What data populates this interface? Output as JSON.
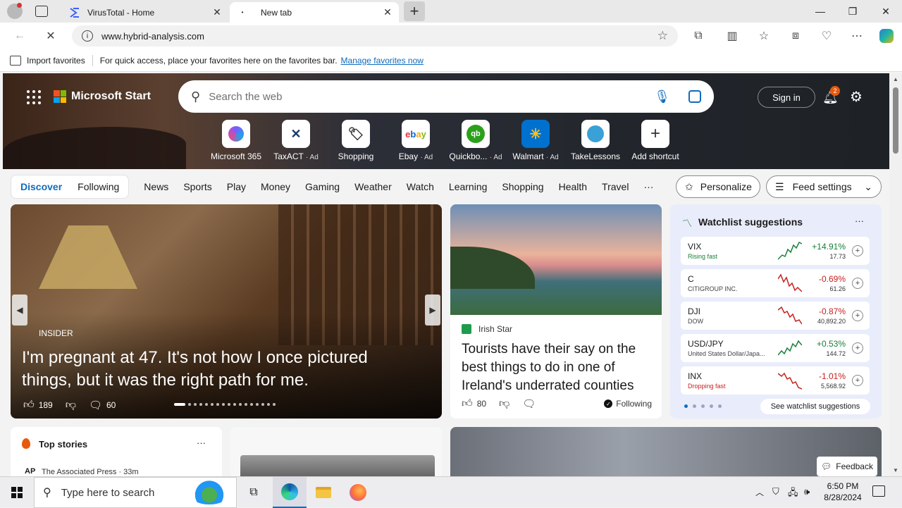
{
  "browser": {
    "tabs": [
      {
        "title": "VirusTotal - Home",
        "active": false
      },
      {
        "title": "New tab",
        "active": true
      }
    ],
    "url": "www.hybrid-analysis.com",
    "favorites_bar": {
      "import_label": "Import favorites",
      "hint": "For quick access, place your favorites here on the favorites bar.",
      "manage_link": "Manage favorites now"
    }
  },
  "msn": {
    "brand": "Microsoft Start",
    "search_placeholder": "Search the web",
    "signin_label": "Sign in",
    "notification_count": "2",
    "shortcuts": [
      {
        "label": "Microsoft 365",
        "ad": "",
        "icon": "m365-icon"
      },
      {
        "label": "TaxACT",
        "ad": "· Ad",
        "icon": "taxact-icon"
      },
      {
        "label": "Shopping",
        "ad": "",
        "icon": "shopping-tag-icon"
      },
      {
        "label": "Ebay",
        "ad": "· Ad",
        "icon": "ebay-icon"
      },
      {
        "label": "Quickbo...",
        "ad": "· Ad",
        "icon": "quickbooks-icon"
      },
      {
        "label": "Walmart",
        "ad": "· Ad",
        "icon": "walmart-icon"
      },
      {
        "label": "TakeLessons",
        "ad": "",
        "icon": "takelessons-icon"
      },
      {
        "label": "Add shortcut",
        "ad": "",
        "icon": "plus-icon"
      }
    ],
    "nav": {
      "discover": "Discover",
      "following": "Following",
      "items": [
        "News",
        "Sports",
        "Play",
        "Money",
        "Gaming",
        "Weather",
        "Watch",
        "Learning",
        "Shopping",
        "Health",
        "Travel"
      ],
      "more": "···",
      "personalize": "Personalize",
      "feed_settings": "Feed settings"
    },
    "main_story": {
      "source": "INSIDER",
      "headline": "I'm pregnant at 47. It's not how I once pictured things, but it was the right path for me.",
      "likes": "189",
      "comments": "60"
    },
    "side_story": {
      "source": "Irish Star",
      "headline": "Tourists have their say on the best things to do in one of Ireland's underrated counties",
      "likes": "80",
      "following": "Following"
    },
    "watchlist": {
      "title": "Watchlist suggestions",
      "more": "···",
      "rows": [
        {
          "symbol": "VIX",
          "sub": "Rising fast",
          "change": "+14.91%",
          "price": "17.73",
          "dir": "up"
        },
        {
          "symbol": "C",
          "sub": "CITIGROUP INC.",
          "change": "-0.69%",
          "price": "61.26",
          "dir": "down"
        },
        {
          "symbol": "DJI",
          "sub": "DOW",
          "change": "-0.87%",
          "price": "40,892.20",
          "dir": "down"
        },
        {
          "symbol": "USD/JPY",
          "sub": "United States Dollar/Japa...",
          "change": "+0.53%",
          "price": "144.72",
          "dir": "up"
        },
        {
          "symbol": "INX",
          "sub": "Dropping fast",
          "change": "-1.01%",
          "price": "5,568.92",
          "dir": "down"
        }
      ],
      "see_more": "See watchlist suggestions"
    },
    "top_stories": {
      "title": "Top stories",
      "source": "The Associated Press · 33m"
    },
    "feedback": "Feedback"
  },
  "taskbar": {
    "search_placeholder": "Type here to search",
    "time": "6:50 PM",
    "date": "8/28/2024"
  },
  "colors": {
    "accent": "#0f6cbd",
    "up": "#188038",
    "down": "#c5221f"
  }
}
